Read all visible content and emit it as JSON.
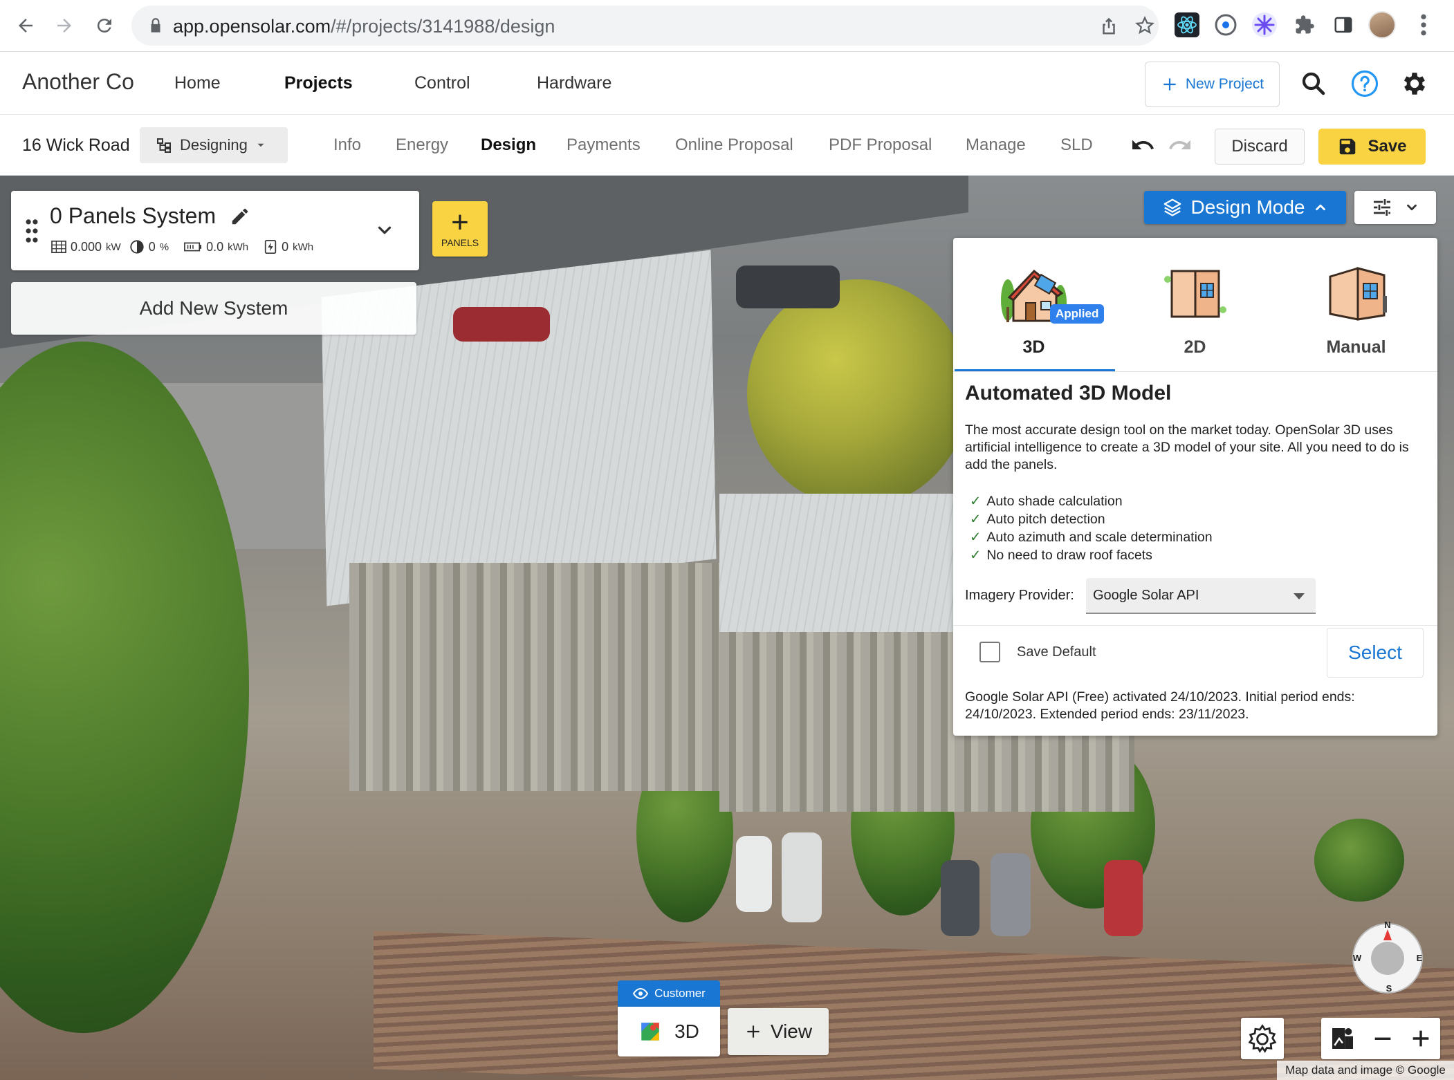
{
  "browser": {
    "url_host": "app.opensolar.com",
    "url_path": "/#/projects/3141988/design"
  },
  "header": {
    "brand": "Another Co",
    "nav": [
      "Home",
      "Projects",
      "Control",
      "Hardware"
    ],
    "active_nav": "Projects",
    "new_project_label": "New Project"
  },
  "project": {
    "address": "16 Wick Road",
    "stage": "Designing",
    "tabs": [
      "Info",
      "Energy",
      "Design",
      "Payments",
      "Online Proposal",
      "PDF Proposal",
      "Manage",
      "SLD"
    ],
    "active_tab": "Design",
    "discard_label": "Discard",
    "save_label": "Save"
  },
  "system": {
    "title": "0 Panels System",
    "kw": "0.000",
    "kw_unit": "kW",
    "offset": "0",
    "offset_unit": "%",
    "battery": "0.0",
    "battery_unit": "kWh",
    "energy": "0",
    "energy_unit": "kWh",
    "panels_label": "PANELS",
    "add_system_label": "Add New System"
  },
  "design_mode": {
    "button_label": "Design Mode",
    "tabs": [
      {
        "label": "3D",
        "badge": "Applied"
      },
      {
        "label": "2D"
      },
      {
        "label": "Manual"
      }
    ],
    "active_tab": "3D",
    "title": "Automated 3D Model",
    "description": "The most accurate design tool on the market today. OpenSolar 3D uses artificial intelligence to create a 3D model of your site. All you need to do is add the panels.",
    "features": [
      "Auto shade calculation",
      "Auto pitch detection",
      "Auto azimuth and scale determination",
      "No need to draw roof facets"
    ],
    "imagery_label": "Imagery Provider:",
    "imagery_value": "Google Solar API",
    "save_default_label": "Save Default",
    "select_label": "Select",
    "notice": "Google Solar API (Free) activated 24/10/2023. Initial period ends: 24/10/2023. Extended period ends: 23/11/2023."
  },
  "map": {
    "customer_label": "Customer",
    "view_mode": "3D",
    "add_view_label": "View",
    "compass": {
      "n": "N",
      "e": "E",
      "s": "S",
      "w": "W"
    },
    "attribution": "Map data and image © Google"
  },
  "colors": {
    "primary": "#1976d2",
    "save_yellow": "#f9d342",
    "check_green": "#2e7d32"
  }
}
